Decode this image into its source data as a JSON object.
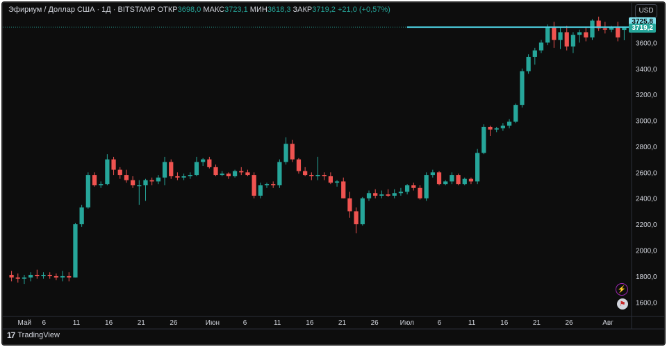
{
  "legend": {
    "symbol": "Эфириум / Доллар США · 1Д · BITSTAMP",
    "open_label": "ОТКР",
    "open": "3698,0",
    "high_label": "МАКС",
    "high": "3723,1",
    "low_label": "МИН",
    "low": "3618,3",
    "close_label": "ЗАКР",
    "close": "3719,2",
    "change": "+21,0 (+0,57%)"
  },
  "currency": "USD",
  "price_tags": {
    "high_tag": "3725,8",
    "last_tag": "3719,2",
    "high_value": 3725.8,
    "last_value": 3719.2
  },
  "brand": "TradingView",
  "icons": [
    "lightning-icon",
    "flag-icon",
    "tradingview-logo-icon"
  ],
  "colors": {
    "up": "#26a69a",
    "down": "#ef5350",
    "last_line": "#4dd0e1",
    "background": "#0d0d0d",
    "text": "#d1d4dc"
  },
  "chart_data": {
    "type": "candlestick",
    "ylim": [
      1500,
      3800
    ],
    "y_ticks": [
      "1600,0",
      "1800,0",
      "2000,0",
      "2200,0",
      "2400,0",
      "2600,0",
      "2800,0",
      "3000,0",
      "3200,0",
      "3400,0",
      "3600,0"
    ],
    "y_tick_values": [
      1600,
      1800,
      2000,
      2200,
      2400,
      2600,
      2800,
      3000,
      3200,
      3400,
      3600
    ],
    "x_ticks": [
      {
        "label": "Май",
        "day": 3
      },
      {
        "label": "6",
        "day": 6
      },
      {
        "label": "11",
        "day": 11
      },
      {
        "label": "16",
        "day": 16
      },
      {
        "label": "21",
        "day": 21
      },
      {
        "label": "26",
        "day": 26
      },
      {
        "label": "Июн",
        "day": 32
      },
      {
        "label": "6",
        "day": 37
      },
      {
        "label": "11",
        "day": 42
      },
      {
        "label": "16",
        "day": 47
      },
      {
        "label": "21",
        "day": 52
      },
      {
        "label": "26",
        "day": 57
      },
      {
        "label": "Июл",
        "day": 62
      },
      {
        "label": "6",
        "day": 67
      },
      {
        "label": "11",
        "day": 72
      },
      {
        "label": "16",
        "day": 77
      },
      {
        "label": "21",
        "day": 82
      },
      {
        "label": "26",
        "day": 87
      },
      {
        "label": "Авг",
        "day": 93
      }
    ],
    "candles": [
      [
        1810,
        1840,
        1760,
        1790
      ],
      [
        1790,
        1820,
        1750,
        1780
      ],
      [
        1780,
        1810,
        1740,
        1790
      ],
      [
        1790,
        1830,
        1760,
        1810
      ],
      [
        1810,
        1850,
        1780,
        1800
      ],
      [
        1800,
        1830,
        1780,
        1810
      ],
      [
        1810,
        1830,
        1780,
        1800
      ],
      [
        1800,
        1820,
        1770,
        1790
      ],
      [
        1790,
        1840,
        1760,
        1800
      ],
      [
        1800,
        1830,
        1760,
        1790
      ],
      [
        1790,
        2210,
        1790,
        2200
      ],
      [
        2200,
        2350,
        2180,
        2330
      ],
      [
        2330,
        2600,
        2320,
        2580
      ],
      [
        2580,
        2600,
        2490,
        2500
      ],
      [
        2500,
        2530,
        2480,
        2510
      ],
      [
        2510,
        2740,
        2500,
        2700
      ],
      [
        2700,
        2720,
        2580,
        2620
      ],
      [
        2620,
        2640,
        2550,
        2580
      ],
      [
        2580,
        2620,
        2520,
        2540
      ],
      [
        2540,
        2570,
        2480,
        2500
      ],
      [
        2500,
        2540,
        2350,
        2500
      ],
      [
        2500,
        2550,
        2380,
        2540
      ],
      [
        2540,
        2560,
        2500,
        2530
      ],
      [
        2530,
        2580,
        2510,
        2560
      ],
      [
        2560,
        2720,
        2500,
        2680
      ],
      [
        2680,
        2700,
        2550,
        2570
      ],
      [
        2570,
        2600,
        2540,
        2560
      ],
      [
        2560,
        2590,
        2540,
        2570
      ],
      [
        2570,
        2600,
        2550,
        2580
      ],
      [
        2580,
        2720,
        2570,
        2680
      ],
      [
        2680,
        2710,
        2650,
        2700
      ],
      [
        2700,
        2720,
        2630,
        2640
      ],
      [
        2640,
        2660,
        2570,
        2580
      ],
      [
        2580,
        2610,
        2570,
        2590
      ],
      [
        2590,
        2600,
        2550,
        2570
      ],
      [
        2570,
        2620,
        2560,
        2610
      ],
      [
        2610,
        2640,
        2580,
        2600
      ],
      [
        2600,
        2620,
        2570,
        2580
      ],
      [
        2580,
        2600,
        2400,
        2420
      ],
      [
        2420,
        2520,
        2400,
        2500
      ],
      [
        2500,
        2520,
        2480,
        2510
      ],
      [
        2510,
        2530,
        2480,
        2500
      ],
      [
        2500,
        2700,
        2480,
        2680
      ],
      [
        2680,
        2870,
        2660,
        2820
      ],
      [
        2820,
        2850,
        2680,
        2700
      ],
      [
        2700,
        2710,
        2590,
        2610
      ],
      [
        2610,
        2640,
        2570,
        2580
      ],
      [
        2580,
        2600,
        2540,
        2570
      ],
      [
        2570,
        2720,
        2540,
        2580
      ],
      [
        2580,
        2600,
        2540,
        2570
      ],
      [
        2570,
        2600,
        2510,
        2520
      ],
      [
        2520,
        2540,
        2490,
        2530
      ],
      [
        2530,
        2560,
        2400,
        2400
      ],
      [
        2400,
        2450,
        2250,
        2300
      ],
      [
        2300,
        2330,
        2130,
        2200
      ],
      [
        2200,
        2410,
        2190,
        2400
      ],
      [
        2400,
        2460,
        2380,
        2440
      ],
      [
        2440,
        2470,
        2400,
        2420
      ],
      [
        2420,
        2460,
        2400,
        2430
      ],
      [
        2430,
        2470,
        2410,
        2420
      ],
      [
        2420,
        2470,
        2400,
        2440
      ],
      [
        2440,
        2480,
        2420,
        2450
      ],
      [
        2450,
        2510,
        2430,
        2500
      ],
      [
        2500,
        2520,
        2460,
        2480
      ],
      [
        2480,
        2500,
        2390,
        2400
      ],
      [
        2400,
        2600,
        2380,
        2580
      ],
      [
        2580,
        2620,
        2560,
        2600
      ],
      [
        2600,
        2610,
        2500,
        2510
      ],
      [
        2510,
        2540,
        2500,
        2530
      ],
      [
        2530,
        2600,
        2510,
        2580
      ],
      [
        2580,
        2590,
        2500,
        2510
      ],
      [
        2510,
        2560,
        2500,
        2550
      ],
      [
        2550,
        2560,
        2510,
        2530
      ],
      [
        2530,
        2780,
        2510,
        2750
      ],
      [
        2750,
        2970,
        2740,
        2950
      ],
      [
        2950,
        2960,
        2880,
        2930
      ],
      [
        2930,
        2950,
        2910,
        2940
      ],
      [
        2940,
        2980,
        2920,
        2960
      ],
      [
        2960,
        3010,
        2940,
        2990
      ],
      [
        2990,
        3130,
        2980,
        3120
      ],
      [
        3120,
        3400,
        3100,
        3380
      ],
      [
        3380,
        3510,
        3360,
        3490
      ],
      [
        3490,
        3560,
        3430,
        3540
      ],
      [
        3540,
        3620,
        3520,
        3600
      ],
      [
        3600,
        3740,
        3580,
        3720
      ],
      [
        3720,
        3760,
        3560,
        3620
      ],
      [
        3620,
        3720,
        3550,
        3680
      ],
      [
        3680,
        3730,
        3540,
        3570
      ],
      [
        3570,
        3680,
        3520,
        3660
      ],
      [
        3660,
        3700,
        3600,
        3680
      ],
      [
        3680,
        3720,
        3610,
        3640
      ],
      [
        3640,
        3780,
        3620,
        3770
      ],
      [
        3770,
        3800,
        3690,
        3710
      ],
      [
        3710,
        3760,
        3670,
        3700
      ],
      [
        3700,
        3730,
        3680,
        3720
      ],
      [
        3720,
        3760,
        3610,
        3640
      ],
      [
        3698,
        3723.1,
        3618.3,
        3719.2
      ]
    ]
  }
}
